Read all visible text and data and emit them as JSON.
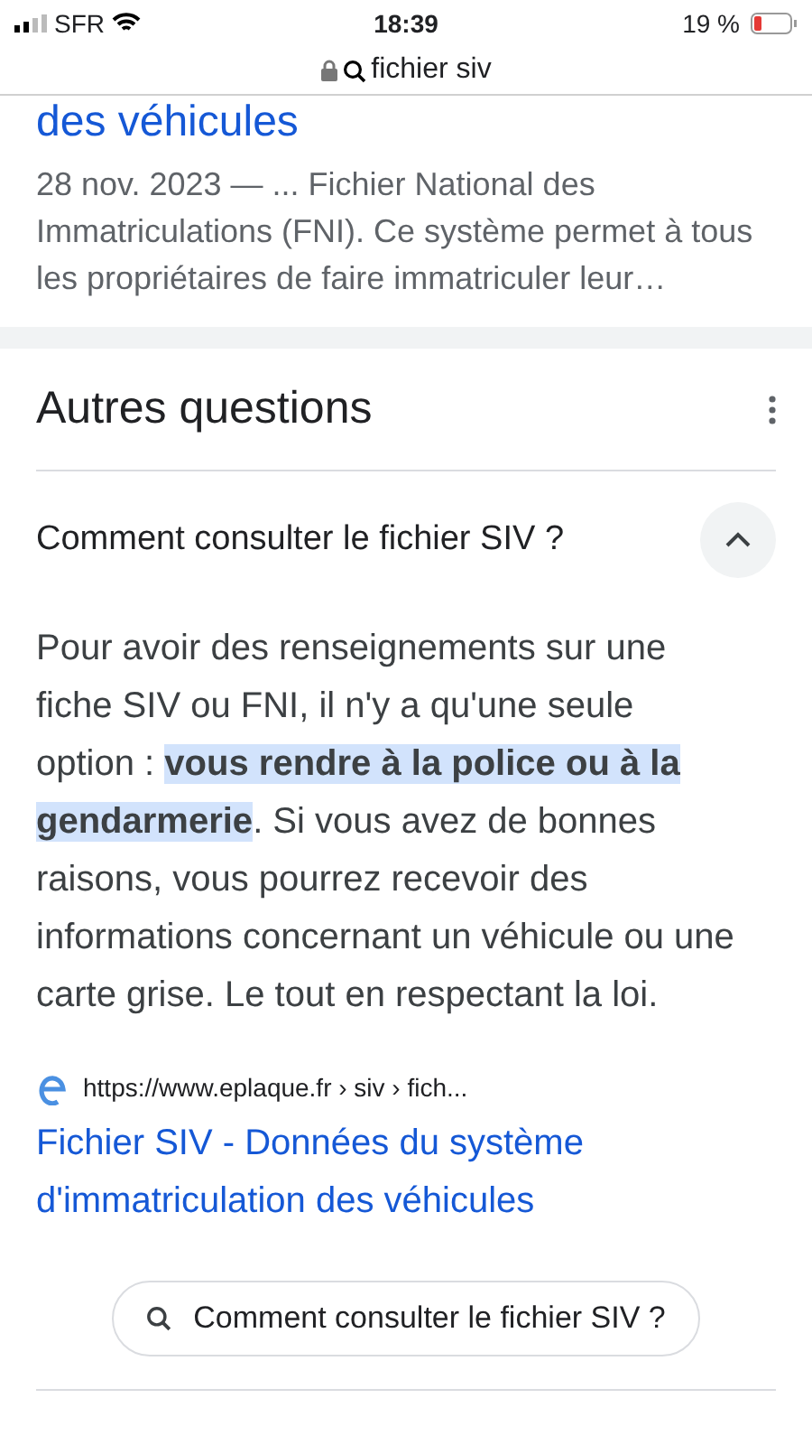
{
  "status_bar": {
    "carrier": "SFR",
    "time": "18:39",
    "battery": "19 %"
  },
  "address_bar": {
    "query": "fichier siv"
  },
  "previous_result": {
    "title_fragment": "des véhicules",
    "snippet": "28 nov. 2023 — ... Fichier National des Immatriculations (FNI). Ce système permet à tous les propriétaires de faire immatriculer leur…"
  },
  "questions": {
    "title": "Autres questions",
    "items": [
      {
        "question": "Comment consulter le fichier SIV ?",
        "expanded": true,
        "answer": "Pour avoir des renseignements sur une fiche SIV ou FNI, il n'y a qu'une seule option : **vous rendre à la police ou à la gendarmerie**. Si vous avez de bonnes raisons, vous pourrez recevoir des informations concernant un véhicule ou une carte grise. Le tout en respectant la loi.",
        "source_url": "https://www.eplaque.fr › siv › fich...",
        "source_title": "Fichier SIV - Données du système d'immatriculation des véhicules",
        "search_chip": "Comment consulter le fichier SIV ?"
      }
    ]
  }
}
